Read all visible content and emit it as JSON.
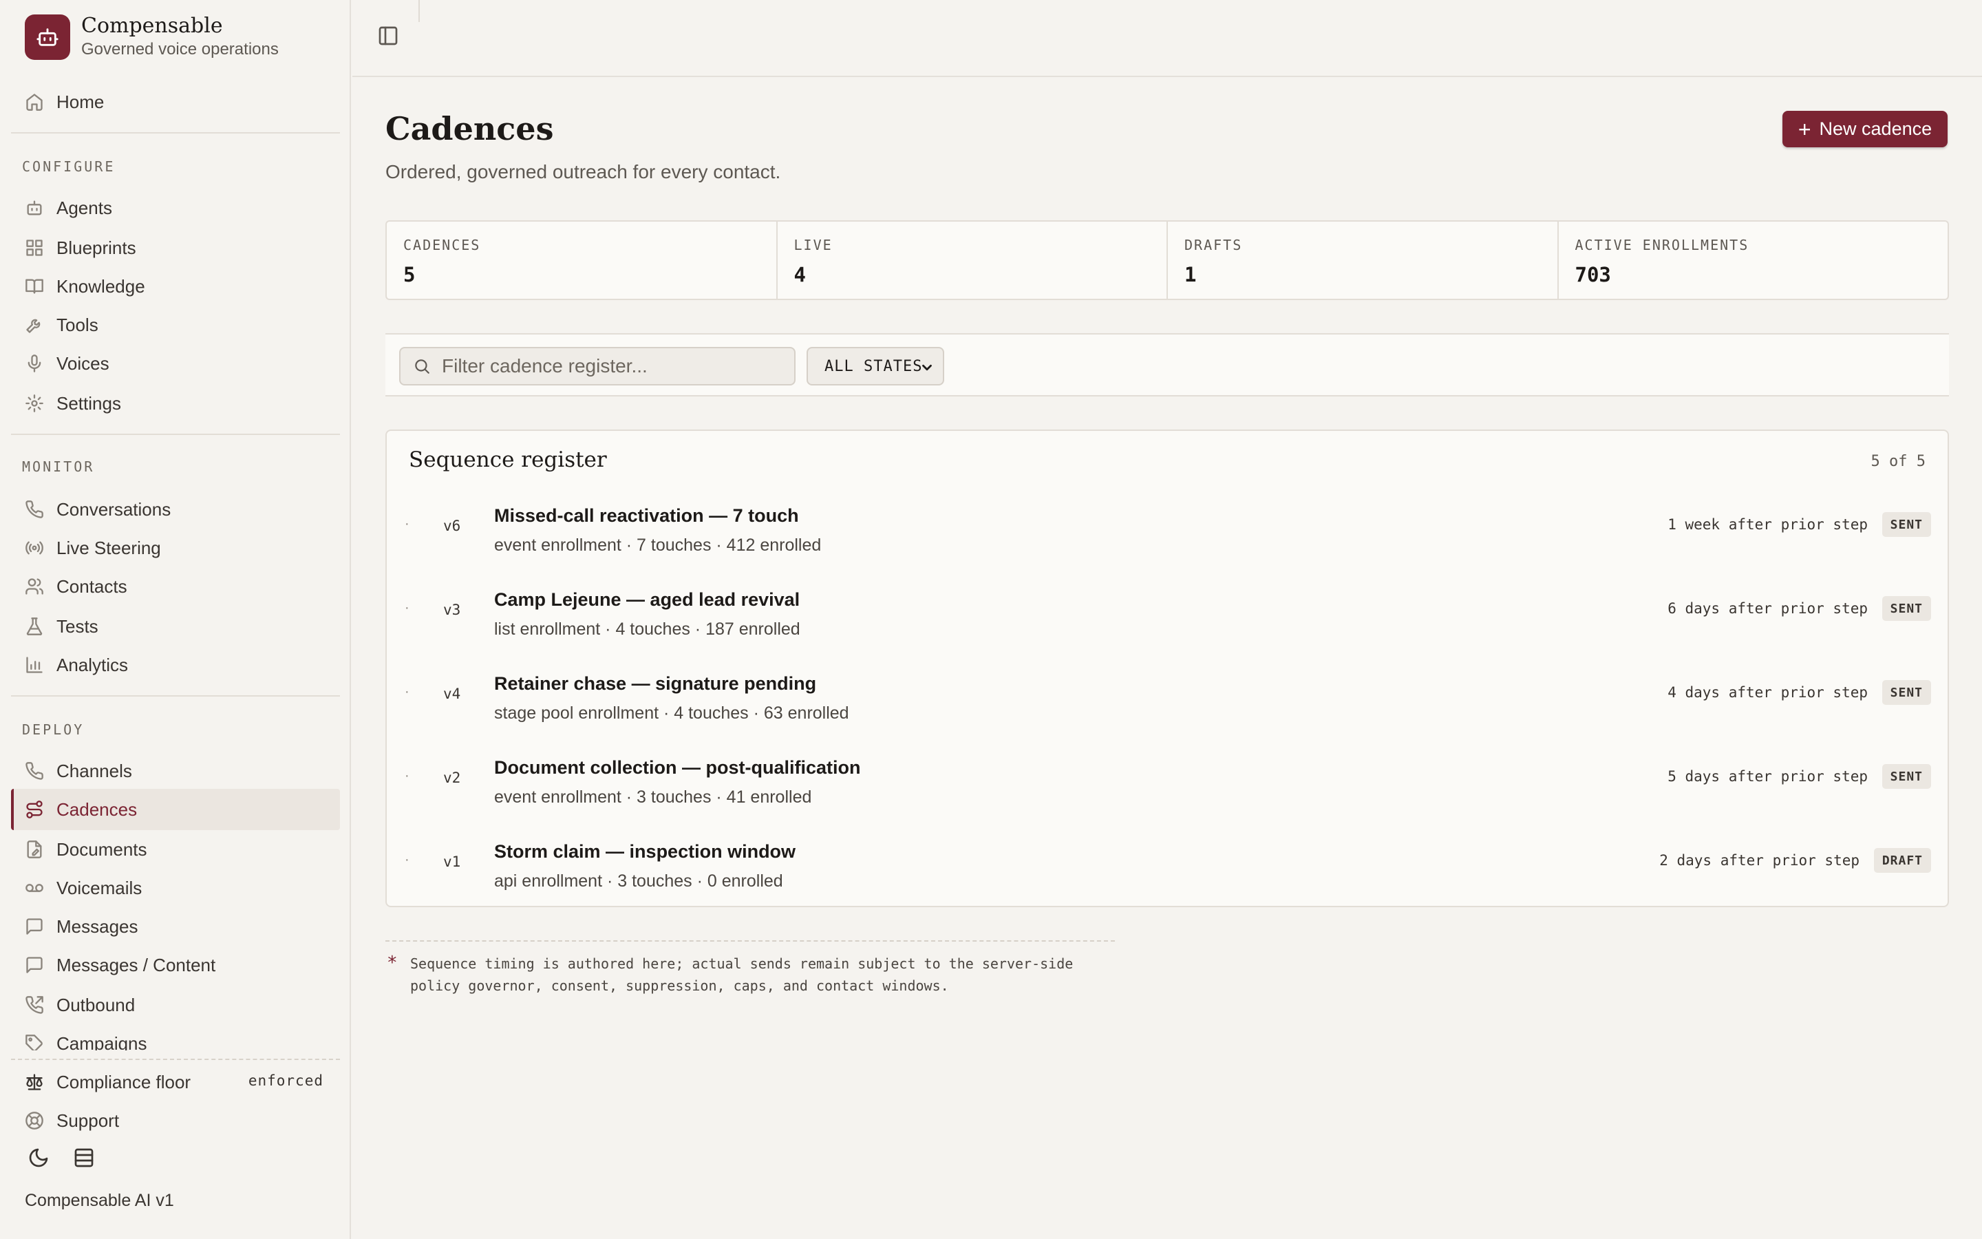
{
  "brand": {
    "name": "Compensable",
    "tagline": "Governed voice operations"
  },
  "sidebar": {
    "home": "Home",
    "configure_label": "CONFIGURE",
    "configure": [
      "Agents",
      "Blueprints",
      "Knowledge",
      "Tools",
      "Voices",
      "Settings"
    ],
    "monitor_label": "MONITOR",
    "monitor": [
      "Conversations",
      "Live Steering",
      "Contacts",
      "Tests",
      "Analytics"
    ],
    "deploy_label": "DEPLOY",
    "deploy": [
      "Channels",
      "Cadences",
      "Documents",
      "Voicemails",
      "Messages",
      "Messages / Content",
      "Outbound",
      "Campaigns"
    ],
    "active_item": "Cadences",
    "compliance": "Compliance floor",
    "compliance_status": "enforced",
    "support": "Support",
    "version": "Compensable AI v1"
  },
  "page": {
    "title": "Cadences",
    "subtitle": "Ordered, governed outreach for every contact.",
    "new_button": "New cadence"
  },
  "stats": [
    {
      "label": "CADENCES",
      "value": "5"
    },
    {
      "label": "LIVE",
      "value": "4"
    },
    {
      "label": "DRAFTS",
      "value": "1"
    },
    {
      "label": "ACTIVE ENROLLMENTS",
      "value": "703"
    }
  ],
  "filter": {
    "search_placeholder": "Filter cadence register...",
    "state_select": "ALL STATES"
  },
  "register": {
    "title": "Sequence register",
    "count": "5 of 5",
    "rows": [
      {
        "bullet": "·",
        "version": "v6",
        "name": "Missed-call reactivation — 7 touch",
        "meta": "event enrollment · 7 touches · 412 enrolled",
        "timing": "1 week after prior step",
        "status": "SENT"
      },
      {
        "bullet": "·",
        "version": "v3",
        "name": "Camp Lejeune — aged lead revival",
        "meta": "list enrollment · 4 touches · 187 enrolled",
        "timing": "6 days after prior step",
        "status": "SENT"
      },
      {
        "bullet": "·",
        "version": "v4",
        "name": "Retainer chase — signature pending",
        "meta": "stage pool enrollment · 4 touches · 63 enrolled",
        "timing": "4 days after prior step",
        "status": "SENT"
      },
      {
        "bullet": "·",
        "version": "v2",
        "name": "Document collection — post-qualification",
        "meta": "event enrollment · 3 touches · 41 enrolled",
        "timing": "5 days after prior step",
        "status": "SENT"
      },
      {
        "bullet": "·",
        "version": "v1",
        "name": "Storm claim — inspection window",
        "meta": "api enrollment · 3 touches · 0 enrolled",
        "timing": "2 days after prior step",
        "status": "DRAFT"
      }
    ]
  },
  "footnote": {
    "mark": "*",
    "text": "Sequence timing is authored here; actual sends remain subject to the server-side policy governor, consent, suppression, caps, and contact windows."
  },
  "colors": {
    "accent": "#7b2433",
    "background": "#f5f3ef",
    "panel": "#fbfaf7"
  }
}
